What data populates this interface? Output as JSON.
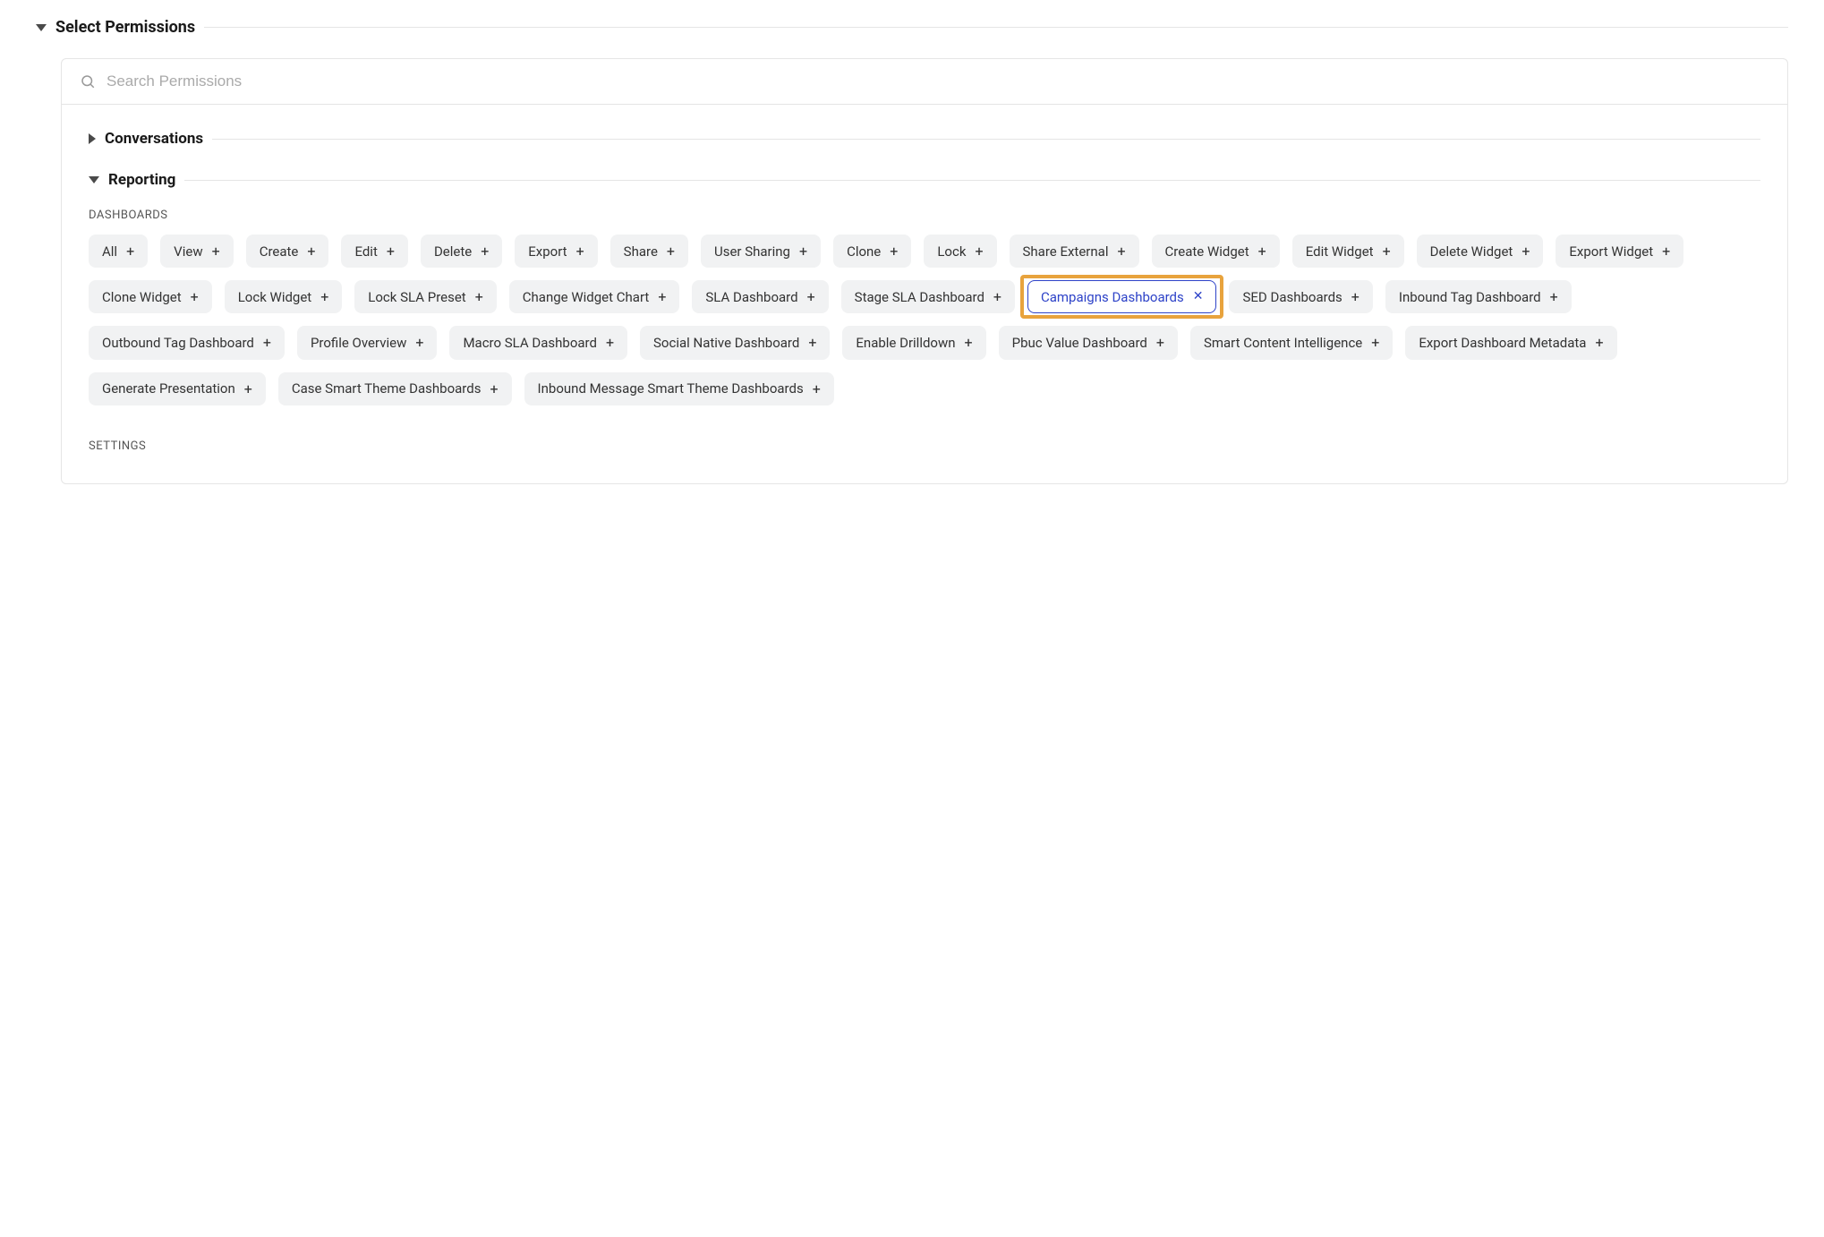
{
  "header": {
    "title": "Select Permissions"
  },
  "search": {
    "placeholder": "Search Permissions"
  },
  "groups": {
    "conversations": {
      "title": "Conversations"
    },
    "reporting": {
      "title": "Reporting",
      "subgroups": {
        "dashboards": {
          "label": "DASHBOARDS",
          "chips": [
            {
              "label": "All",
              "selected": false
            },
            {
              "label": "View",
              "selected": false
            },
            {
              "label": "Create",
              "selected": false
            },
            {
              "label": "Edit",
              "selected": false
            },
            {
              "label": "Delete",
              "selected": false
            },
            {
              "label": "Export",
              "selected": false
            },
            {
              "label": "Share",
              "selected": false
            },
            {
              "label": "User Sharing",
              "selected": false
            },
            {
              "label": "Clone",
              "selected": false
            },
            {
              "label": "Lock",
              "selected": false
            },
            {
              "label": "Share External",
              "selected": false
            },
            {
              "label": "Create Widget",
              "selected": false
            },
            {
              "label": "Edit Widget",
              "selected": false
            },
            {
              "label": "Delete Widget",
              "selected": false
            },
            {
              "label": "Export Widget",
              "selected": false
            },
            {
              "label": "Clone Widget",
              "selected": false
            },
            {
              "label": "Lock Widget",
              "selected": false
            },
            {
              "label": "Lock SLA Preset",
              "selected": false
            },
            {
              "label": "Change Widget Chart",
              "selected": false
            },
            {
              "label": "SLA Dashboard",
              "selected": false
            },
            {
              "label": "Stage SLA Dashboard",
              "selected": false
            },
            {
              "label": "Campaigns Dashboards",
              "selected": true,
              "highlighted": true
            },
            {
              "label": "SED Dashboards",
              "selected": false
            },
            {
              "label": "Inbound Tag Dashboard",
              "selected": false
            },
            {
              "label": "Outbound Tag Dashboard",
              "selected": false
            },
            {
              "label": "Profile Overview",
              "selected": false
            },
            {
              "label": "Macro SLA Dashboard",
              "selected": false
            },
            {
              "label": "Social Native Dashboard",
              "selected": false
            },
            {
              "label": "Enable Drilldown",
              "selected": false
            },
            {
              "label": "Pbuc Value Dashboard",
              "selected": false
            },
            {
              "label": "Smart Content Intelligence",
              "selected": false
            },
            {
              "label": "Export Dashboard Metadata",
              "selected": false
            },
            {
              "label": "Generate Presentation",
              "selected": false
            },
            {
              "label": "Case Smart Theme Dashboards",
              "selected": false
            },
            {
              "label": "Inbound Message Smart Theme Dashboards",
              "selected": false
            }
          ]
        },
        "settings": {
          "label": "SETTINGS"
        }
      }
    }
  }
}
